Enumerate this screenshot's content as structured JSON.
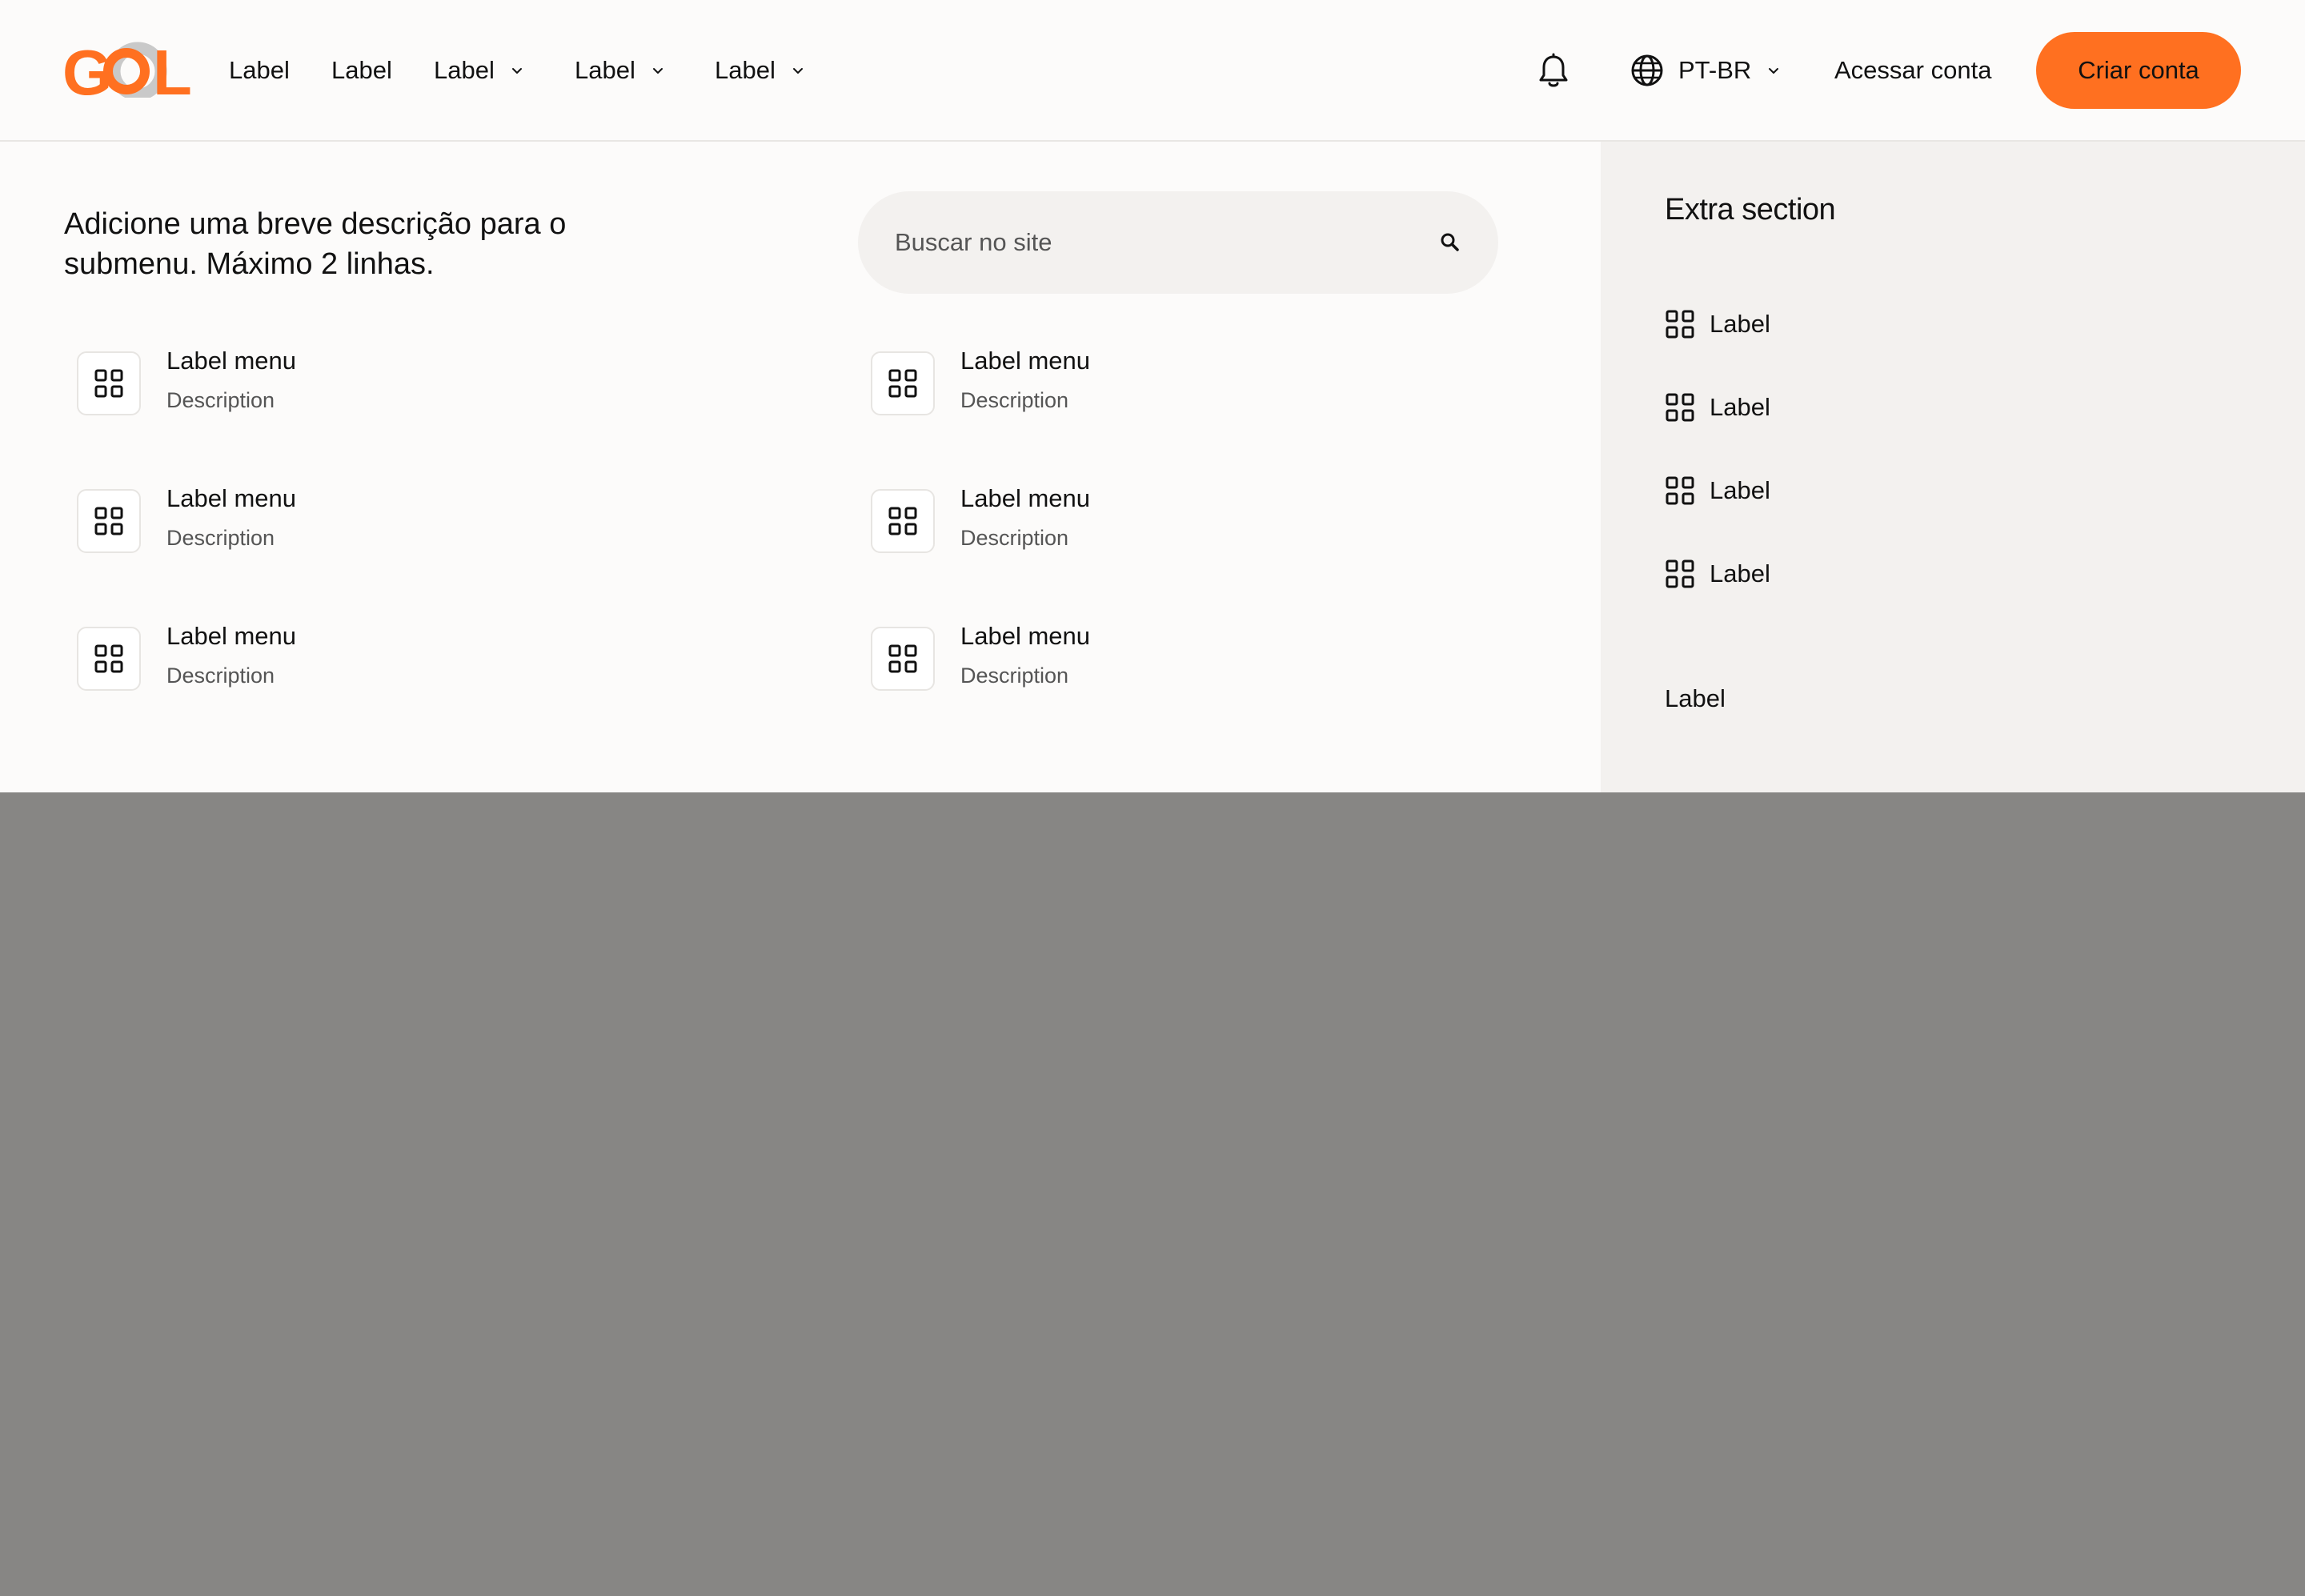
{
  "brand": {
    "logo_text": "GOL",
    "accent_color": "#ff7020",
    "overlay_color": "#878684"
  },
  "nav": {
    "items": [
      {
        "label": "Label",
        "has_dropdown": false
      },
      {
        "label": "Label",
        "has_dropdown": false
      },
      {
        "label": "Label",
        "has_dropdown": true
      },
      {
        "label": "Label",
        "has_dropdown": true
      },
      {
        "label": "Label",
        "has_dropdown": true
      }
    ]
  },
  "header": {
    "notification_icon": "bell-icon",
    "language": {
      "icon": "globe-icon",
      "value": "PT-BR"
    },
    "login_label": "Acessar conta",
    "signup_label": "Criar conta"
  },
  "submenu": {
    "description": "Adicione uma breve descrição para o submenu. Máximo 2 linhas.",
    "search": {
      "placeholder": "Buscar no site",
      "icon": "search-icon"
    },
    "items": [
      {
        "label": "Label menu",
        "description": "Description",
        "icon": "grid-icon"
      },
      {
        "label": "Label menu",
        "description": "Description",
        "icon": "grid-icon"
      },
      {
        "label": "Label menu",
        "description": "Description",
        "icon": "grid-icon"
      },
      {
        "label": "Label menu",
        "description": "Description",
        "icon": "grid-icon"
      },
      {
        "label": "Label menu",
        "description": "Description",
        "icon": "grid-icon"
      },
      {
        "label": "Label menu",
        "description": "Description",
        "icon": "grid-icon"
      }
    ]
  },
  "extra": {
    "title": "Extra section",
    "links": [
      {
        "label": "Label",
        "icon": "grid-icon"
      },
      {
        "label": "Label",
        "icon": "grid-icon"
      },
      {
        "label": "Label",
        "icon": "grid-icon"
      },
      {
        "label": "Label",
        "icon": "grid-icon"
      }
    ],
    "bottom_label": "Label"
  }
}
